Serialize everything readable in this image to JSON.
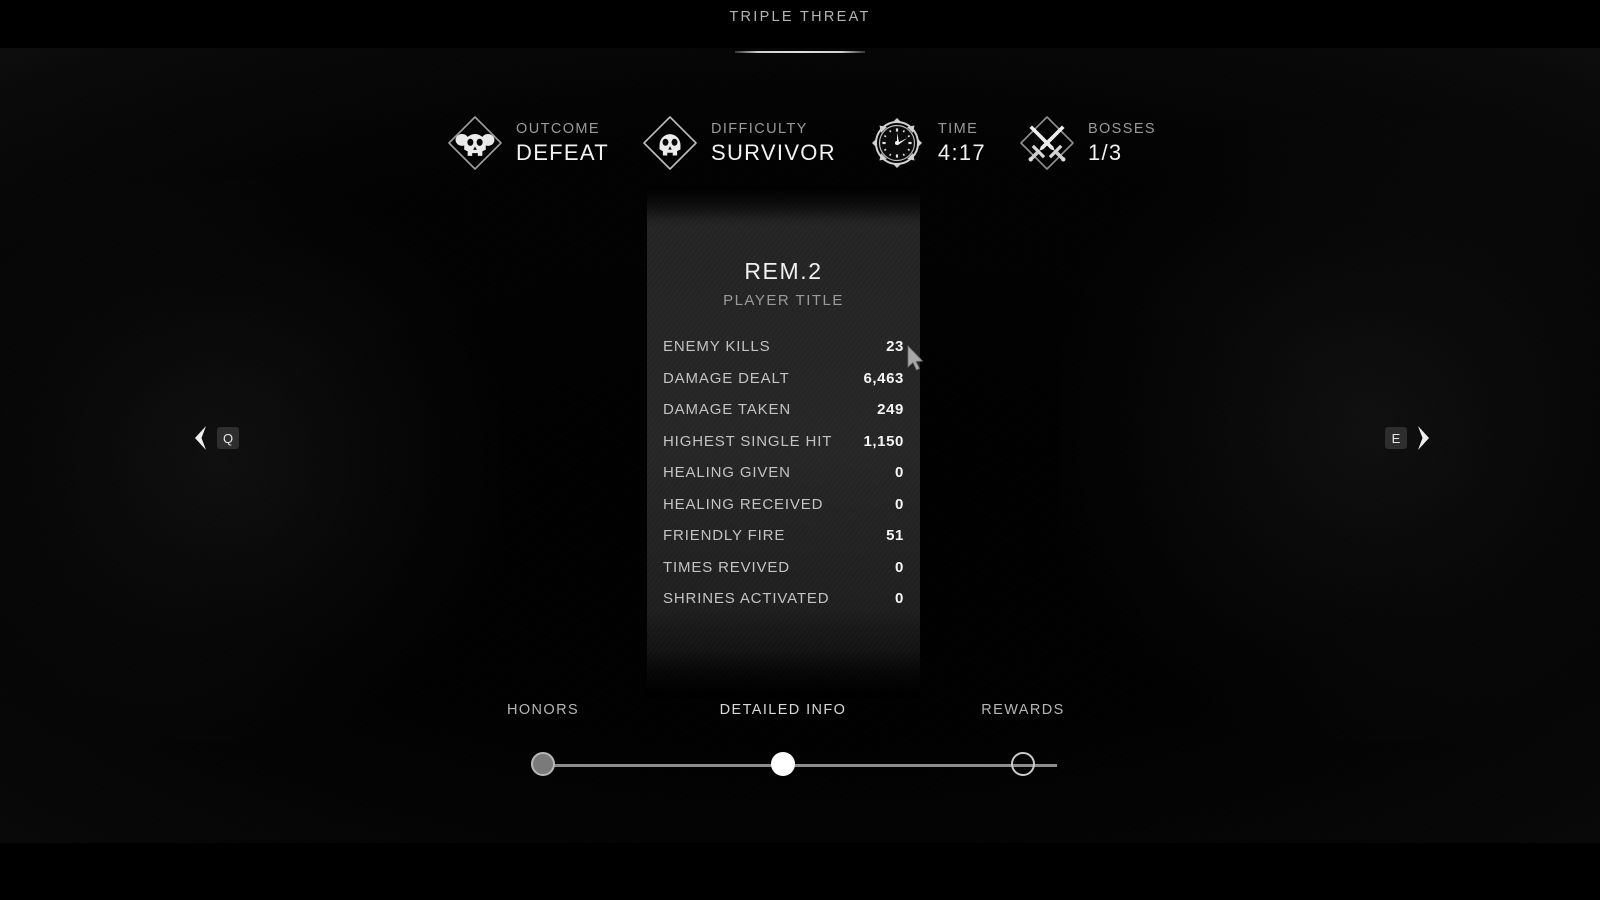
{
  "header_tab": {
    "label": "TRIPLE THREAT"
  },
  "summary_stats": [
    {
      "icon": "skull-winged-icon",
      "label": "OUTCOME",
      "value": "DEFEAT"
    },
    {
      "icon": "skull-icon",
      "label": "DIFFICULTY",
      "value": "SURVIVOR"
    },
    {
      "icon": "stopwatch-icon",
      "label": "TIME",
      "value": "4:17"
    },
    {
      "icon": "crossed-swords-icon",
      "label": "BOSSES",
      "value": "1/3"
    }
  ],
  "player": {
    "name": "REM.2",
    "subtitle": "PLAYER TITLE"
  },
  "detailed_stats": [
    {
      "label": "ENEMY KILLS",
      "value": "23"
    },
    {
      "label": "DAMAGE DEALT",
      "value": "6,463"
    },
    {
      "label": "DAMAGE TAKEN",
      "value": "249"
    },
    {
      "label": "HIGHEST SINGLE HIT",
      "value": "1,150"
    },
    {
      "label": "HEALING GIVEN",
      "value": "0"
    },
    {
      "label": "HEALING RECEIVED",
      "value": "0"
    },
    {
      "label": "FRIENDLY FIRE",
      "value": "51"
    },
    {
      "label": "TIMES REVIVED",
      "value": "0"
    },
    {
      "label": "SHRINES ACTIVATED",
      "value": "0"
    }
  ],
  "nav": {
    "prev": {
      "key": "Q",
      "icon": "chevron-left-icon"
    },
    "next": {
      "key": "E",
      "icon": "chevron-right-icon"
    }
  },
  "stepper": {
    "steps": [
      {
        "label": "HONORS",
        "state": "done"
      },
      {
        "label": "DETAILED INFO",
        "state": "active"
      },
      {
        "label": "REWARDS",
        "state": "pending"
      }
    ]
  },
  "colors": {
    "accent": "#ffffff",
    "label_gray": "#9a9a9a",
    "value_white": "#f2f2f2",
    "panel_bg": "#262626"
  }
}
